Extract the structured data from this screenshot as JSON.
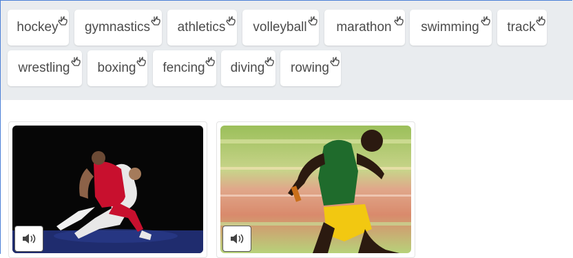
{
  "word_bank": {
    "chips": [
      {
        "label": "hockey"
      },
      {
        "label": "gymnastics"
      },
      {
        "label": "athletics"
      },
      {
        "label": "volleyball"
      },
      {
        "label": "marathon"
      },
      {
        "label": "swimming"
      },
      {
        "label": "track"
      },
      {
        "label": "wrestling"
      },
      {
        "label": "boxing"
      },
      {
        "label": "fencing"
      },
      {
        "label": "diving"
      },
      {
        "label": "rowing"
      }
    ],
    "drag_icon": "hand-pointer-icon"
  },
  "cards": [
    {
      "image": "wrestling-photo",
      "audio_icon": "speaker-icon"
    },
    {
      "image": "sprinter-photo",
      "audio_icon": "speaker-icon"
    }
  ],
  "colors": {
    "accent_border": "#4a7fd6",
    "word_bank_bg": "#e9ecef",
    "chip_text": "#4b4b4b"
  }
}
